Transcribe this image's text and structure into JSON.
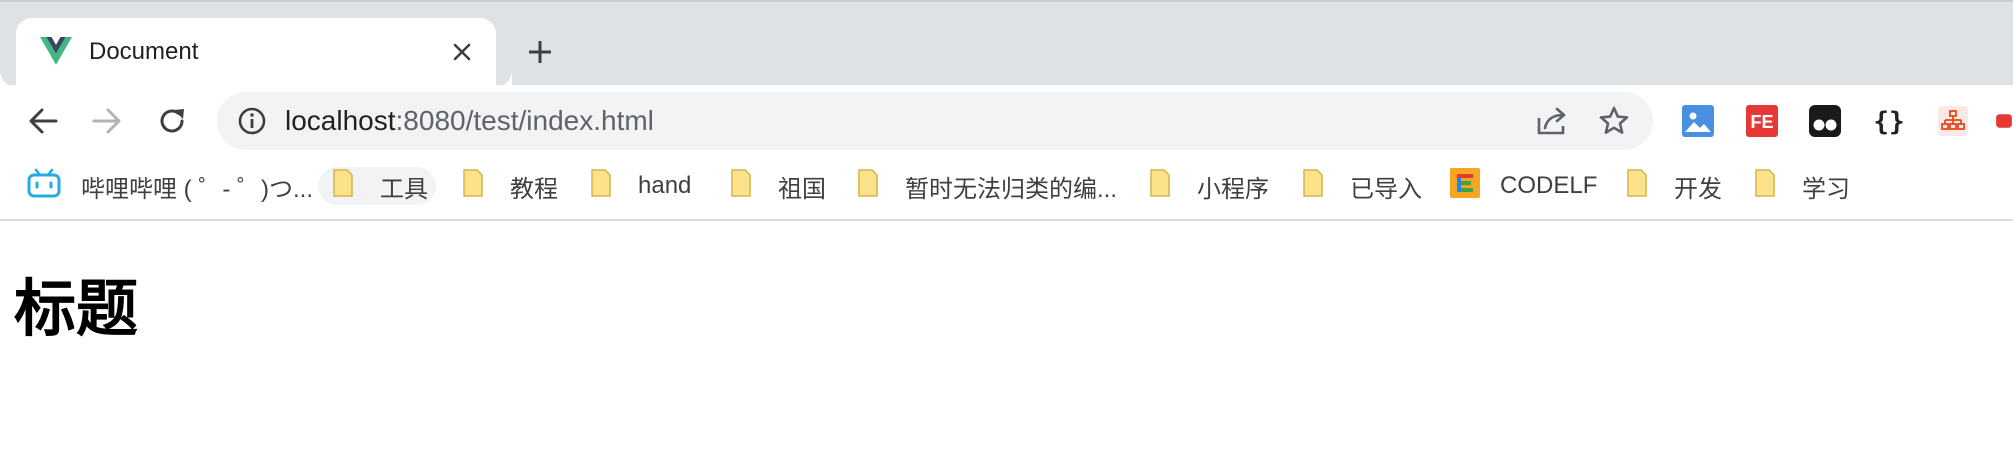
{
  "tab": {
    "title": "Document",
    "favicon": "vue-logo-icon"
  },
  "address_bar": {
    "host": "localhost",
    "path": ":8080/test/index.html"
  },
  "bookmarks": [
    {
      "label": "哔哩哔哩 ( ゜- ゜)つ...",
      "icon": "bilibili-icon"
    },
    {
      "label": "工具",
      "icon": "folder-icon"
    },
    {
      "label": "教程",
      "icon": "folder-icon"
    },
    {
      "label": "hand",
      "icon": "folder-icon"
    },
    {
      "label": "祖国",
      "icon": "folder-icon"
    },
    {
      "label": "暂时无法归类的编...",
      "icon": "folder-icon"
    },
    {
      "label": "小程序",
      "icon": "folder-icon"
    },
    {
      "label": "已导入",
      "icon": "folder-icon"
    },
    {
      "label": "CODELF",
      "icon": "codelf-icon"
    },
    {
      "label": "开发",
      "icon": "folder-icon"
    },
    {
      "label": "学习",
      "icon": "folder-icon"
    }
  ],
  "extensions": [
    {
      "name": "image-extension-icon"
    },
    {
      "name": "fe-helper-icon"
    },
    {
      "name": "tampermonkey-icon"
    },
    {
      "name": "json-formatter-icon"
    },
    {
      "name": "sitemap-extension-icon"
    },
    {
      "name": "red-extension-icon"
    }
  ],
  "page": {
    "heading": "标题"
  },
  "colors": {
    "tab_strip": "#dee1e6",
    "omnibox": "#f1f3f4",
    "folder": "#fce28a",
    "vue_green": "#41b883",
    "vue_dark": "#35495e"
  }
}
